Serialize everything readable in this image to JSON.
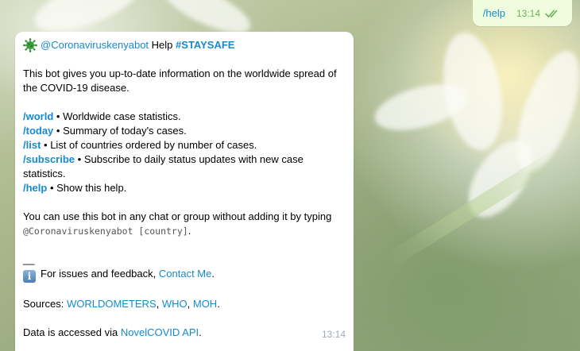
{
  "outgoing": {
    "text": "/help",
    "time": "13:14"
  },
  "bot_message": {
    "bot_name": "@Coronaviruskenyabot",
    "header_word": "Help",
    "hashtag": "#STAYSAFE",
    "intro": "This bot gives you up-to-date information on the worldwide spread of the COVID-19 disease.",
    "commands": [
      {
        "cmd": "/world",
        "sep": " • ",
        "desc": "Worldwide case statistics."
      },
      {
        "cmd": "/today",
        "sep": " • ",
        "desc": "Summary of today's cases."
      },
      {
        "cmd": "/list",
        "sep": " • ",
        "desc": "List of countries ordered by number of cases."
      },
      {
        "cmd": "/subscribe",
        "sep": " • ",
        "desc": "Subscribe to daily status updates with new case statistics."
      },
      {
        "cmd": "/help",
        "sep": " • ",
        "desc": "Show this help."
      }
    ],
    "usage_prefix": "You can use this bot in any chat or group without adding it by typing",
    "usage_code": "@Coronaviruskenyabot [country]",
    "usage_suffix": ".",
    "divider": "__",
    "feedback_text": "For issues and feedback,",
    "feedback_link": "Contact Me",
    "feedback_suffix": ".",
    "sources_label": "Sources:",
    "sources": [
      "WORLDOMETERS",
      "WHO",
      "MOH"
    ],
    "data_prefix": "Data is accessed via",
    "data_link": "NovelCOVID API",
    "data_suffix": ".",
    "time": "13:14"
  },
  "colors": {
    "link": "#168acd",
    "outgoing_bg": "#effdde",
    "read_check": "#6cb257"
  }
}
